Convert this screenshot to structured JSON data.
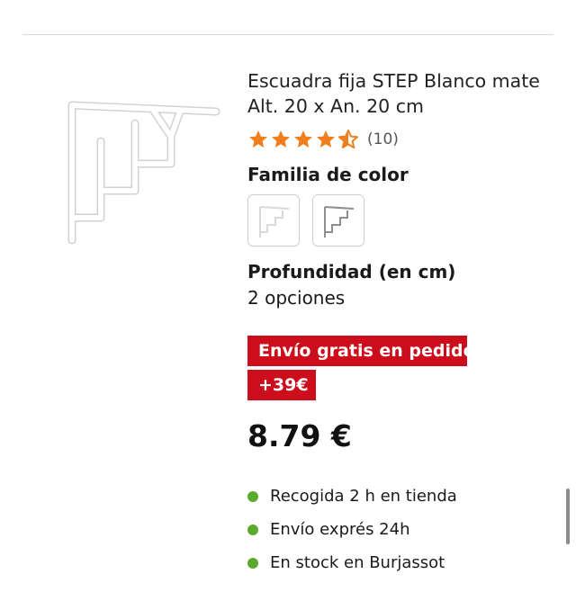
{
  "product": {
    "title_line1": "Escuadra fija STEP Blanco mate",
    "title_line2": "Alt. 20 x An. 20 cm",
    "rating": 4.5,
    "rating_max": 5,
    "review_count": "(10)",
    "star_color": "#f07e1d"
  },
  "color_family": {
    "heading": "Familia de color",
    "swatches": [
      {
        "name": "Blanco",
        "color": "#ffffff",
        "selected": false
      },
      {
        "name": "Gris",
        "color": "#8e8e8e",
        "selected": false
      }
    ]
  },
  "depth": {
    "heading": "Profundidad (en cm)",
    "options": "2 opciones"
  },
  "promo": {
    "line1": "Envío gratis en pedidos",
    "line2": "+39€",
    "color": "#cc0e1c"
  },
  "price": "8.79 €",
  "availability": [
    {
      "label": "Recogida 2 h en tienda",
      "color": "#5aab2b"
    },
    {
      "label": "Envío exprés 24h",
      "color": "#5aab2b"
    },
    {
      "label": "En stock en Burjassot",
      "color": "#5aab2b"
    }
  ]
}
